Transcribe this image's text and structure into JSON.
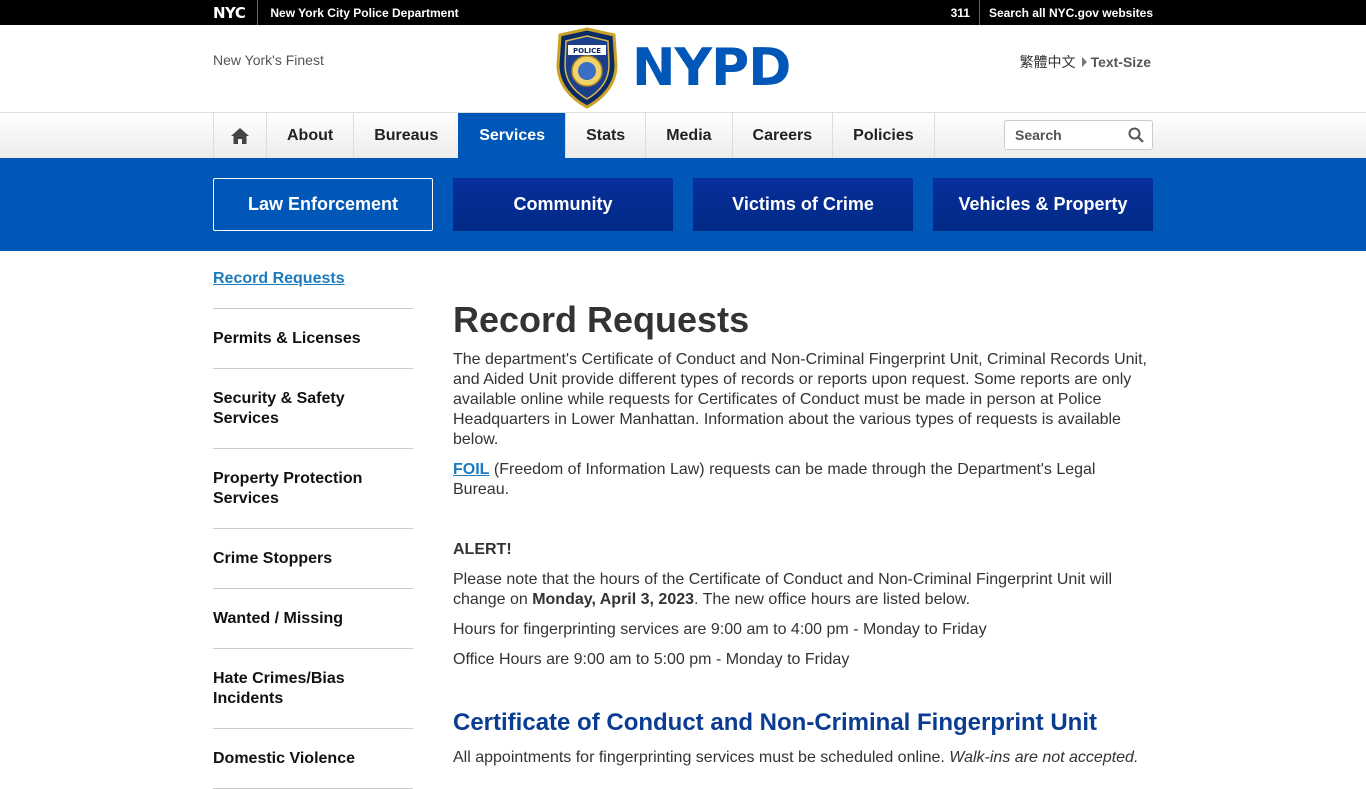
{
  "nycbar": {
    "logo": "NYC",
    "dept": "New York City Police Department",
    "link_311": "311",
    "search_all": "Search all NYC.gov websites"
  },
  "header": {
    "tagline": "New York's Finest",
    "brand": "NYPD",
    "lang": "繁體中文",
    "text_size": "Text-Size",
    "badge_icon": "nypd-shield-badge"
  },
  "nav": {
    "items": [
      "About",
      "Bureaus",
      "Services",
      "Stats",
      "Media",
      "Careers",
      "Policies"
    ],
    "active": "Services",
    "search_placeholder": "Search"
  },
  "categories": [
    "Law Enforcement",
    "Community",
    "Victims of Crime",
    "Vehicles & Property"
  ],
  "sidebar": {
    "title": "Record Requests",
    "items": [
      "Permits & Licenses",
      "Security & Safety Services",
      "Property Protection Services",
      "Crime Stoppers",
      "Wanted / Missing",
      "Hate Crimes/Bias Incidents",
      "Domestic Violence"
    ]
  },
  "main": {
    "title": "Record Requests",
    "intro": "The department's Certificate of Conduct and Non-Criminal Fingerprint Unit, Criminal Records Unit, and Aided Unit provide different types of records or reports upon request. Some reports are only available online while requests for Certificates of Conduct must be made in person at Police Headquarters in Lower Manhattan. Information about the various types of requests is available below.",
    "foil_link": "FOIL",
    "foil_text": " (Freedom of Information Law) requests can be made through the Department's Legal Bureau.",
    "alert_heading": "ALERT!",
    "alert_text_1": "Please note that the hours of the Certificate of Conduct and Non-Criminal Fingerprint Unit will change on ",
    "alert_date": "Monday, April 3, 2023",
    "alert_text_2": ". The new office hours are listed below.",
    "hours_fingerprint": "Hours for fingerprinting services are 9:00 am to 4:00 pm - Monday to Friday",
    "hours_office": "Office Hours are 9:00 am to 5:00 pm - Monday to Friday",
    "section_heading": "Certificate of Conduct and Non-Criminal Fingerprint Unit",
    "section_text": "All appointments for fingerprinting services must be scheduled online. ",
    "section_text_em": "Walk-ins are not accepted."
  },
  "colors": {
    "brand_blue": "#0057b7",
    "nav_dark_blue": "#0a2e9c",
    "link_blue": "#1a7bbf",
    "heading_blue": "#0a3d91"
  }
}
